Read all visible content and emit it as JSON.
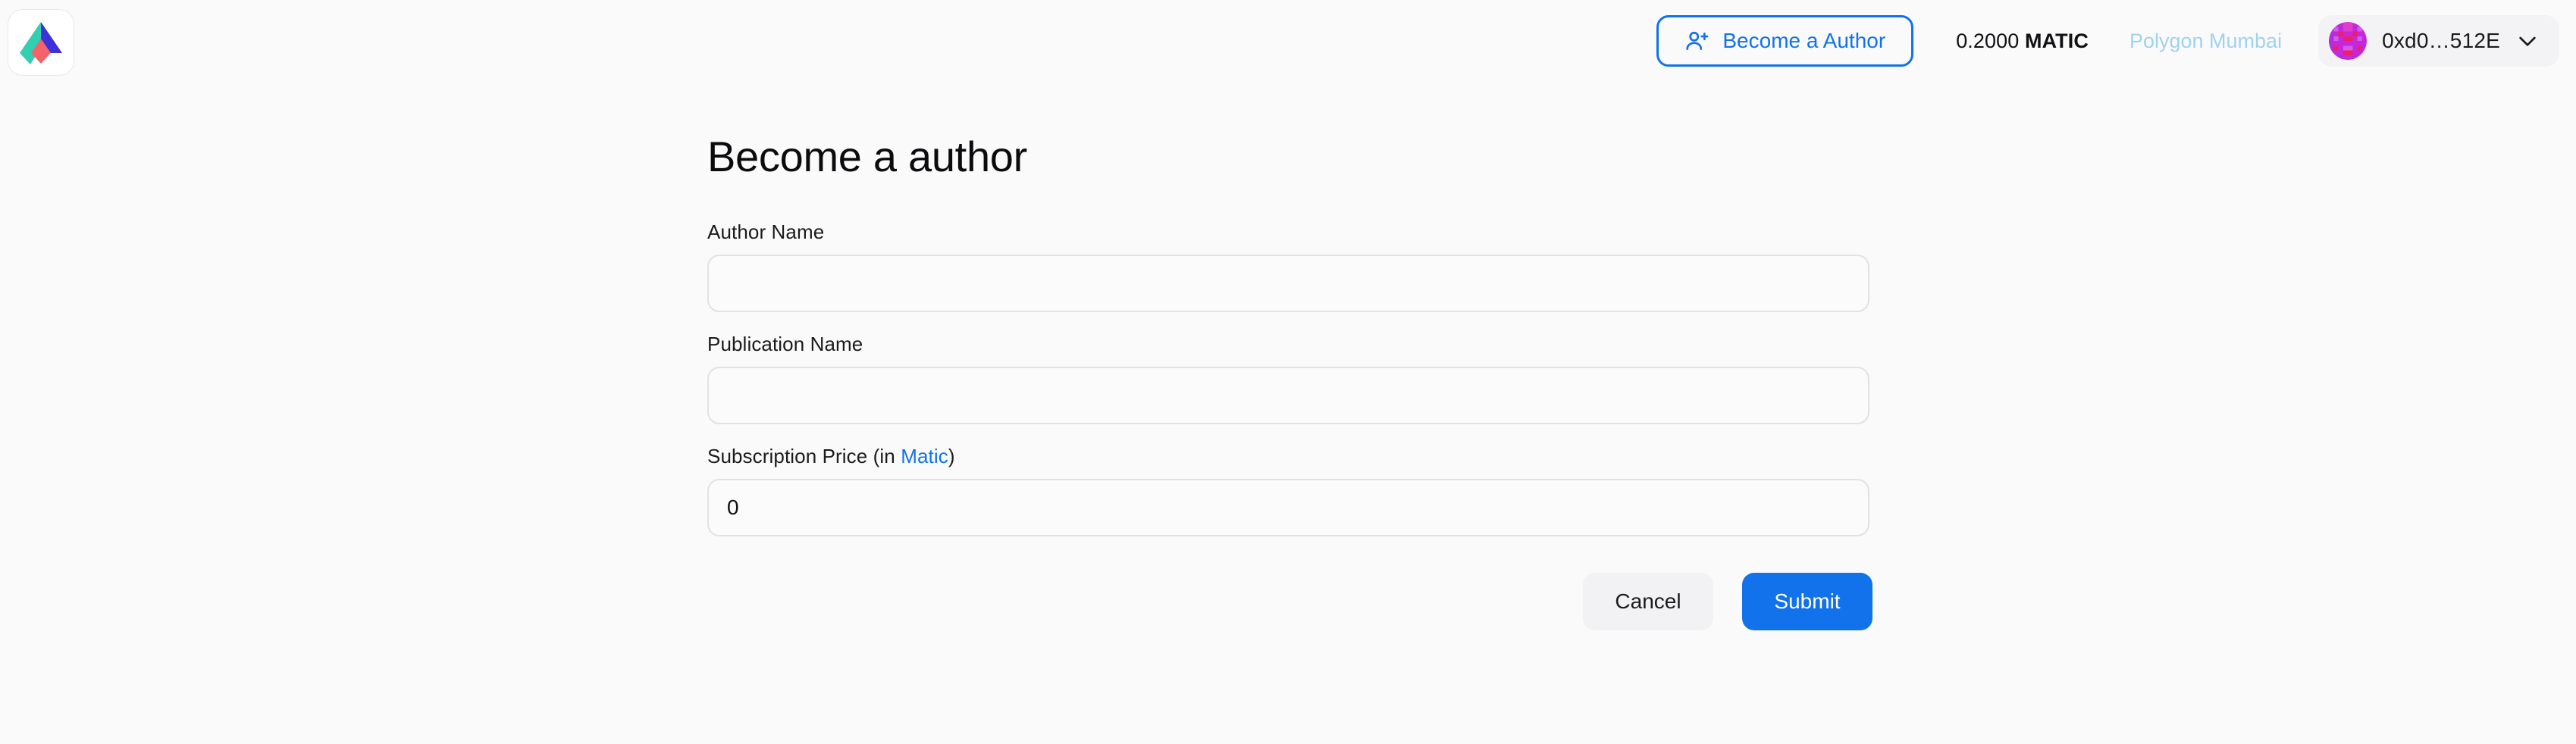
{
  "theme": {
    "background": "#fafafb",
    "accent_blue": "#1272eb",
    "network_text": "#9fd2ef",
    "input_border": "#e2e2e5",
    "cancel_bg": "#f2f2f4",
    "wallet_chip_bg": "#f3f3f5",
    "logo_teal": "#32cfb3",
    "logo_blue": "#3b33d8",
    "logo_red": "#f4636a"
  },
  "header": {
    "logo": {
      "icon": "paper-plane-logo",
      "alt": "App logo"
    },
    "become_author_button": {
      "label": "Become a Author",
      "icon": "person-add-icon"
    },
    "balance": {
      "amount": "0.2000",
      "symbol": "MATIC"
    },
    "network": {
      "label": "Polygon Mumbai"
    },
    "wallet": {
      "address": "0xd0…512E",
      "avatar_icon": "blockies-avatar",
      "chevron_icon": "chevron-down-icon"
    }
  },
  "main": {
    "page_title": "Become a author",
    "form": {
      "fields": [
        {
          "name": "author-name",
          "label": "Author Name",
          "value": "",
          "placeholder": ""
        },
        {
          "name": "publication-name",
          "label": "Publication Name",
          "value": "",
          "placeholder": ""
        },
        {
          "name": "subscription-price",
          "label_prefix": "Subscription Price (in ",
          "label_link": "Matic",
          "label_suffix": ")",
          "value": "0",
          "placeholder": ""
        }
      ],
      "actions": {
        "cancel_label": "Cancel",
        "submit_label": "Submit"
      }
    }
  }
}
